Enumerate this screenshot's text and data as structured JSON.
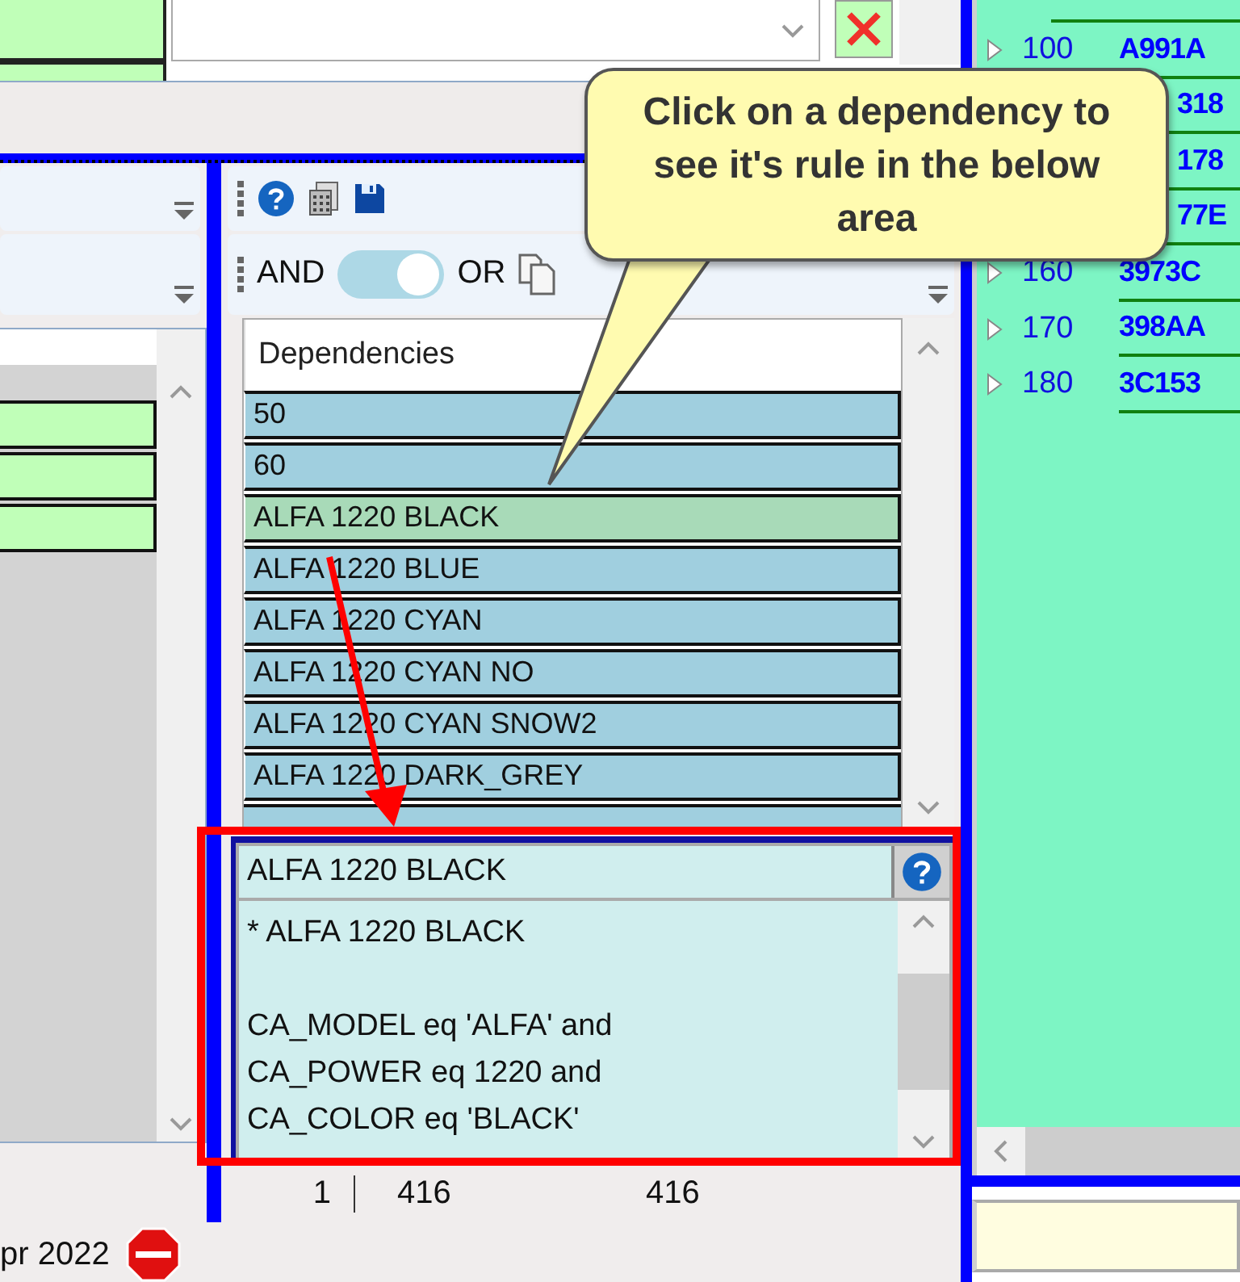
{
  "logic_toggle": {
    "left_label": "AND",
    "right_label": "OR",
    "on": true
  },
  "dependencies": {
    "header": "Dependencies",
    "rows": [
      {
        "label": "50",
        "selected": false
      },
      {
        "label": "60",
        "selected": false
      },
      {
        "label": "ALFA 1220 BLACK",
        "selected": true
      },
      {
        "label": "ALFA 1220 BLUE",
        "selected": false
      },
      {
        "label": "ALFA 1220 CYAN",
        "selected": false
      },
      {
        "label": "ALFA 1220 CYAN NO",
        "selected": false
      },
      {
        "label": "ALFA 1220 CYAN SNOW2",
        "selected": false
      },
      {
        "label": "ALFA 1220 DARK_GREY",
        "selected": false
      }
    ]
  },
  "rule": {
    "title": "ALFA 1220 BLACK",
    "heading": "* ALFA 1220 BLACK",
    "conditions": [
      "CA_MODEL eq 'ALFA' and",
      "CA_POWER eq 1220 and",
      "CA_COLOR eq 'BLACK'"
    ]
  },
  "counts": [
    "1",
    "416",
    "416"
  ],
  "status": {
    "date": "pr 2022"
  },
  "tree": [
    {
      "number": "100",
      "code": "A991A"
    },
    {
      "code": "318"
    },
    {
      "code": "178"
    },
    {
      "code": "77E"
    },
    {
      "number": "160",
      "code": "3973C"
    },
    {
      "number": "170",
      "code": "398AA"
    },
    {
      "number": "180",
      "code": "3C153"
    }
  ],
  "callout": {
    "text": "Click on a dependency to see it's rule in the below area"
  }
}
